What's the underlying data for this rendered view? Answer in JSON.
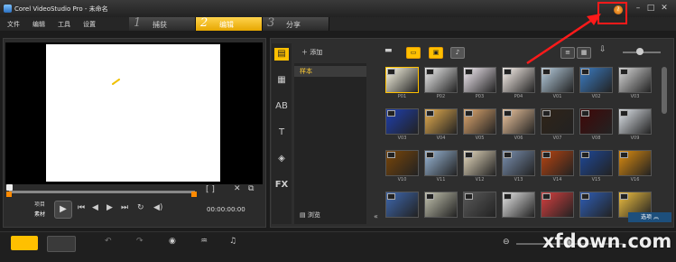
{
  "window": {
    "title": "Corel VideoStudio Pro - 未命名",
    "buttons": [
      "–",
      "□",
      "✕"
    ]
  },
  "menu": [
    "文件",
    "编辑",
    "工具",
    "设置"
  ],
  "steps": [
    {
      "num": "1",
      "label": "捕获"
    },
    {
      "num": "2",
      "label": "编辑"
    },
    {
      "num": "3",
      "label": "分享"
    }
  ],
  "preview": {
    "project_label": "项目",
    "clip_label": "素材",
    "timecode": "00:00:00:00",
    "trim_brackets": "[  ]"
  },
  "library": {
    "add_label": "添加",
    "folder_sample": "样本",
    "browse_label": "浏览",
    "options_label": "选项"
  },
  "thumbnails": [
    {
      "label": "P01",
      "c": "#fffce8"
    },
    {
      "label": "P02",
      "c": "#f2f2f2"
    },
    {
      "label": "P03",
      "c": "#f6eef6"
    },
    {
      "label": "P04",
      "c": "#fff6f0"
    },
    {
      "label": "V01",
      "c": "#b8cfe0"
    },
    {
      "label": "V02",
      "c": "#3c7dc4"
    },
    {
      "label": "V03",
      "c": "#d8d8d8"
    },
    {
      "label": "V03",
      "c": "#1e3fb0"
    },
    {
      "label": "V04",
      "c": "#e8b050"
    },
    {
      "label": "V05",
      "c": "#e2aa70"
    },
    {
      "label": "V06",
      "c": "#f0c8a0"
    },
    {
      "label": "V07",
      "c": "#302418"
    },
    {
      "label": "V08",
      "c": "#400808"
    },
    {
      "label": "V09",
      "c": "#dfe4ea"
    },
    {
      "label": "V10",
      "c": "#7a4608"
    },
    {
      "label": "V11",
      "c": "#9ab8d8"
    },
    {
      "label": "V12",
      "c": "#e8dcc0"
    },
    {
      "label": "V13",
      "c": "#7a90b0"
    },
    {
      "label": "V14",
      "c": "#b84410"
    },
    {
      "label": "V15",
      "c": "#1e4898"
    },
    {
      "label": "V16",
      "c": "#dc8c10"
    },
    {
      "label": "",
      "c": "#3e68b0"
    },
    {
      "label": "",
      "c": "#c4c4b0"
    },
    {
      "label": "",
      "c": "#5a5a5a"
    },
    {
      "label": "",
      "c": "#e6e6e6"
    },
    {
      "label": "",
      "c": "#d84040"
    },
    {
      "label": "",
      "c": "#2f5fb8"
    },
    {
      "label": "",
      "c": "#f0c040"
    }
  ],
  "icons": {
    "help": "help-icon"
  },
  "watermark": "xfdown.com",
  "colors": {
    "accent": "#ffc000",
    "annotation": "#ff1a1a",
    "options_bar": "#1d4f7c"
  }
}
